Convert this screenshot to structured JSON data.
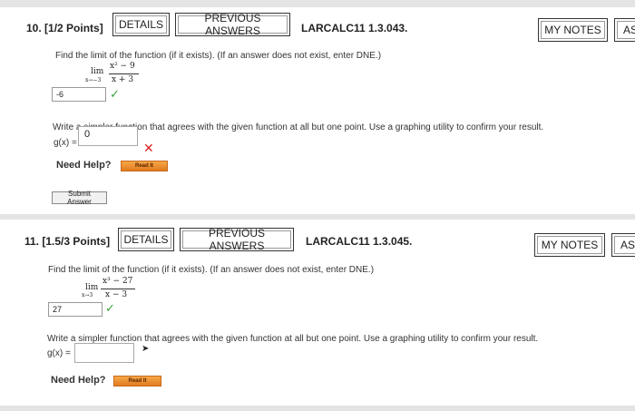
{
  "q10": {
    "number": "10.",
    "points": "[1/2 Points]",
    "details_label": "DETAILS",
    "previous_answers_label": "PREVIOUS ANSWERS",
    "code": "LARCALC11 1.3.043.",
    "my_notes_label": "MY NOTES",
    "ask_label": "AS",
    "prompt": "Find the limit of the function (if it exists). (If an answer does not exist, enter DNE.)",
    "lim": "lim",
    "lim_sub": "x→−3",
    "numerator": "x² − 9",
    "denominator": "x + 3",
    "answer": "-6",
    "part2_prompt": "Write a simpler function that agrees with the given function at all but one point. Use a graphing utility to confirm your result.",
    "g_label": "g(x) =",
    "g_value": "0",
    "need_help": "Need Help?",
    "read_it": "Read It",
    "submit": "Submit Answer"
  },
  "q11": {
    "number": "11.",
    "points": "[1.5/3 Points]",
    "details_label": "DETAILS",
    "previous_answers_label": "PREVIOUS ANSWERS",
    "code": "LARCALC11 1.3.045.",
    "my_notes_label": "MY NOTES",
    "ask_label": "ASI",
    "prompt": "Find the limit of the function (if it exists). (If an answer does not exist, enter DNE.)",
    "lim": "lim",
    "lim_sub": "x→3",
    "numerator": "x³ − 27",
    "denominator": "x − 3",
    "answer": "27",
    "part2_prompt": "Write a simpler function that agrees with the given function at all but one point. Use a graphing utility to confirm your result.",
    "g_label": "g(x) =",
    "g_value": "",
    "need_help": "Need Help?",
    "read_it": "Read It"
  },
  "icons": {
    "correct": "✓",
    "incorrect": "✕",
    "cursor": "➤"
  },
  "colors": {
    "correct": "#3aa13a",
    "incorrect": "#d22222",
    "read_it": "#e07b1f"
  }
}
